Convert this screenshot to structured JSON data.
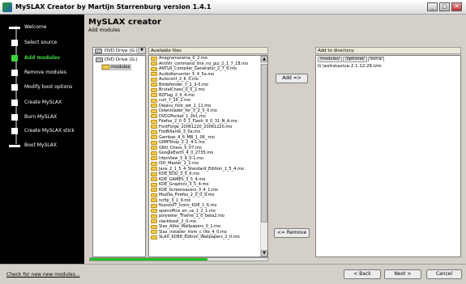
{
  "window": {
    "title": "MySLAX Creator by Martijn Starrenburg version 1.4.1",
    "minimize_glyph": "_",
    "maximize_glyph": "□",
    "close_glyph": "✕"
  },
  "sidebar": {
    "steps": [
      {
        "label": "Welcome",
        "active": false
      },
      {
        "label": "Select source",
        "active": false
      },
      {
        "label": "Add modules",
        "active": true
      },
      {
        "label": "Remove modules",
        "active": false
      },
      {
        "label": "Modify boot options",
        "active": false
      },
      {
        "label": "Create MySLAX",
        "active": false
      },
      {
        "label": "Burn MySLAX",
        "active": false
      },
      {
        "label": "Create MySLAX stick",
        "active": false
      },
      {
        "label": "Boot MySLAX",
        "active": false
      }
    ]
  },
  "header": {
    "title": "MySLAX creator",
    "subtitle": "Add modules"
  },
  "drive": {
    "selected": "DVD Drive (G:)",
    "dropdown_glyph": "▼",
    "tree_root": "DVD Drive (G:)",
    "tree_child": "modules"
  },
  "files": {
    "header": "Available files",
    "items": [
      "Anagramarama_0_2.mo",
      "AntiVir_command_line_no_gui_2_1_7_18.mo",
      "ANTLR_Compiler_Generator_2_7_6.mo",
      "AudioKonverter_5_4_5a.mo",
      "Autoconf_2_6_0.mo",
      "Bitdefender_7_1_3-5.mo",
      "BrutalChess_0_5_2.mo",
      "BZFlag_2_0_4.mo",
      "curl_7_16_2.mo",
      "Dejavu_font_set_1_11.mo",
      "Downloader_for_X_2_5_0.mo",
      "DVD2Pocket_1_2b1.mo",
      "Firefox_2_0_0_1_Flash_9_0_31_N_A.mo",
      "FontForge_20061220_20061220.mo",
      "FooBillards_3_0a.mo",
      "Gambas_4_6_MB_1_06_.mo",
      "GIMPShop_2_2_4-1.mo",
      "GNU_Chess_5_07.mo",
      "GoogleEarth_4_0_2735.mo",
      "IrfanView_3_9_0-1.mo",
      "ISO_Master_1_2.mo",
      "Java_2_1_5_4_Standard_Edition_1_5_4.mo",
      "KDE_EDU_3_5_6.mo",
      "KDE_GAMES_3_5_4.mo",
      "KDE_Graphics_3_5_4.mo",
      "KDE_Screensavers_3_4_1.mo",
      "Mozilla_Firefox_2_0_0_9.mo",
      "ncftp_3_1_9.mo",
      "NuovoXT_icons_KDE_1_6.mo",
      "openoffice_en_us_2_2_1.mo",
      "polyester_Theme_1_0_beta2.mo",
      "slackbook_2_0.mo",
      "Slax_Alike_Wallpapers_0_1.mo",
      "Slax_installer_from_c_lite_4_0.mo",
      "SLAX_KDE8_Edition_Wallpapers_2_0.mo"
    ],
    "scroll_up_glyph": "▲",
    "scroll_down_glyph": "▼"
  },
  "actions": {
    "add_label": "Add =>",
    "remove_label": "<= Remove"
  },
  "destination": {
    "header": "Add to directory:",
    "tabs": [
      "/modules/",
      "/optional/",
      "/extra/"
    ],
    "selected_tab": 2,
    "items": [
      "G:\\extra\\axiva-2.1.12.26.lzm"
    ]
  },
  "progress": {
    "fraction": 0.66
  },
  "footer": {
    "check_link": "Check for new new modules...",
    "back_label": "< Back",
    "next_label": "Next >",
    "cancel_label": "Cancel"
  },
  "colors": {
    "sidebar_bg": "#000000",
    "active_step": "#3ed43e",
    "progress": "#22c022",
    "folder": "#f2c94c"
  }
}
